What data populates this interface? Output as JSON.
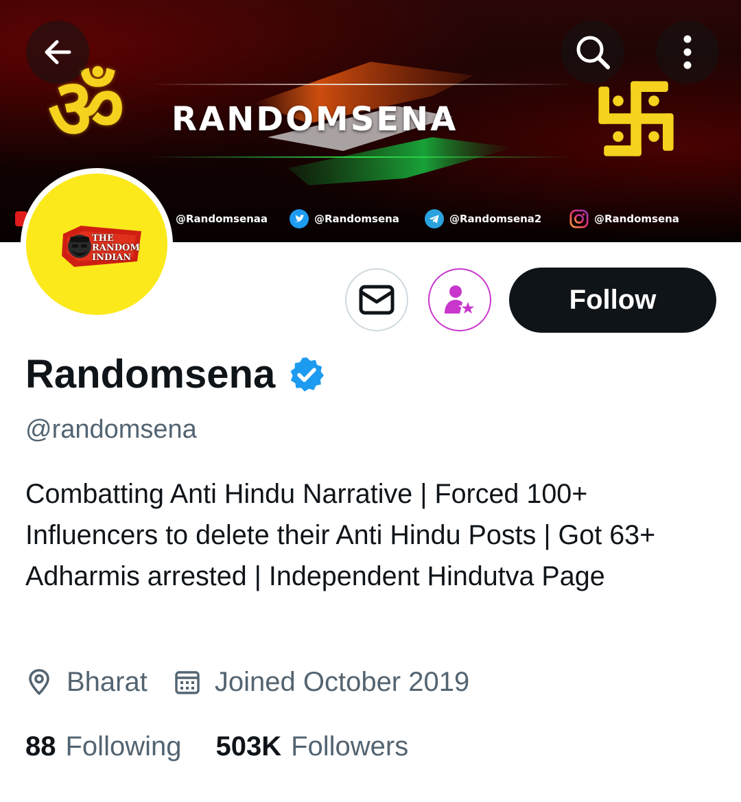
{
  "banner": {
    "title": "RANDOMSENA",
    "om_symbol": "ॐ",
    "socials": [
      {
        "icon": "youtube-icon",
        "handle": "@Randomsenaa"
      },
      {
        "icon": "twitter-icon",
        "handle": "@Randomsena"
      },
      {
        "icon": "telegram-icon",
        "handle": "@Randomsena2"
      },
      {
        "icon": "instagram-icon",
        "handle": "@Randomsena"
      }
    ]
  },
  "top_bar": {
    "back_icon": "arrow-left-icon",
    "search_icon": "search-icon",
    "more_icon": "more-vertical-icon"
  },
  "avatar": {
    "logo_lines": [
      "THE",
      "RANDOM",
      "INDIAN"
    ]
  },
  "actions": {
    "message_icon": "envelope-icon",
    "subscribe_icon": "subscribe-star-icon",
    "follow_label": "Follow"
  },
  "profile": {
    "display_name": "Randomsena",
    "verified": true,
    "handle": "@randomsena",
    "bio": "Combatting Anti Hindu Narrative | Forced 100+ Influencers to delete their Anti Hindu Posts | Got 63+ Adharmis arrested | Independent Hindutva Page",
    "location": "Bharat",
    "joined": "Joined October 2019",
    "following_count": "88",
    "following_label": "Following",
    "followers_count": "503K",
    "followers_label": "Followers"
  },
  "colors": {
    "accent_verified": "#1d9bf0",
    "follow_button": "#0f1419",
    "secondary_text": "#536471",
    "subscribe_accent": "#c936cc",
    "avatar_bg": "#fbe91c"
  }
}
